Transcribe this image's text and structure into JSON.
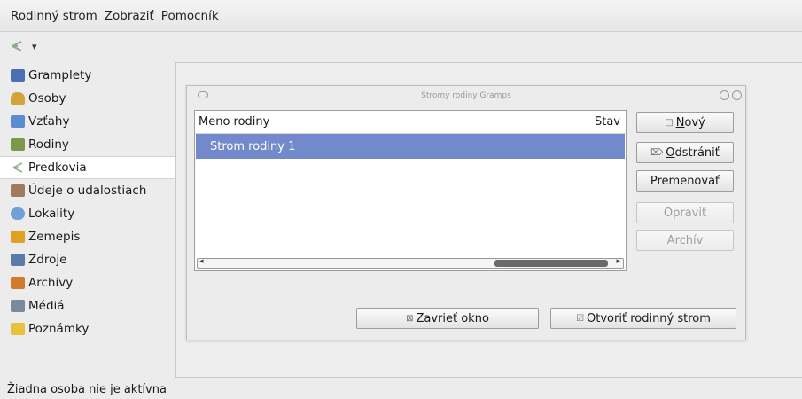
{
  "menubar": {
    "items": [
      "Rodinný strom",
      "Zobraziť",
      "Pomocník"
    ]
  },
  "toolbar": {
    "items": [
      {
        "icon": "tree-back-icon"
      },
      {
        "icon": "dropdown-arrow-icon",
        "glyph": "▾"
      }
    ]
  },
  "sidebar": {
    "active_index": 4,
    "items": [
      {
        "label": "Gramplety",
        "icon": "gramplets-icon",
        "color": "#4a6fb5"
      },
      {
        "label": "Osoby",
        "icon": "people-icon",
        "color": "#d4a23a"
      },
      {
        "label": "Vzťahy",
        "icon": "relationships-icon",
        "color": "#5b8bd1"
      },
      {
        "label": "Rodiny",
        "icon": "families-icon",
        "color": "#7a9a4a"
      },
      {
        "label": "Predkovia",
        "icon": "ancestors-icon",
        "color": "#8fb08f"
      },
      {
        "label": "Údeje o udalostiach",
        "icon": "events-icon",
        "color": "#a07a5a"
      },
      {
        "label": "Lokality",
        "icon": "places-icon",
        "color": "#6fa0d8"
      },
      {
        "label": "Zemepis",
        "icon": "geography-icon",
        "color": "#e0a020"
      },
      {
        "label": "Zdroje",
        "icon": "sources-icon",
        "color": "#5b7aaa"
      },
      {
        "label": "Archívy",
        "icon": "repositories-icon",
        "color": "#d07a2a"
      },
      {
        "label": "Médiá",
        "icon": "media-icon",
        "color": "#7a8a9a"
      },
      {
        "label": "Poznámky",
        "icon": "notes-icon",
        "color": "#e8c23a"
      }
    ]
  },
  "dialog": {
    "title": "Stromy rodiny Gramps",
    "columns": [
      "Meno rodiny",
      "Stav"
    ],
    "rows": [
      {
        "name": "Strom rodiny 1",
        "status": ""
      }
    ],
    "buttons": {
      "new": {
        "accel": "N",
        "rest": "ový",
        "glyph": "□"
      },
      "remove": {
        "accel": "O",
        "rest": "dstrániť",
        "glyph": "⌦"
      },
      "rename": {
        "label": "Premenovať"
      },
      "repair": {
        "label": "Opraviť"
      },
      "archive": {
        "label": "Archív"
      },
      "close": {
        "label": "Zavrieť okno",
        "glyph": "⊠"
      },
      "open": {
        "label": "Otvoriť rodinný strom",
        "glyph": "☑"
      }
    }
  },
  "statusbar": {
    "text": "Žiadna osoba nie je aktívna"
  }
}
